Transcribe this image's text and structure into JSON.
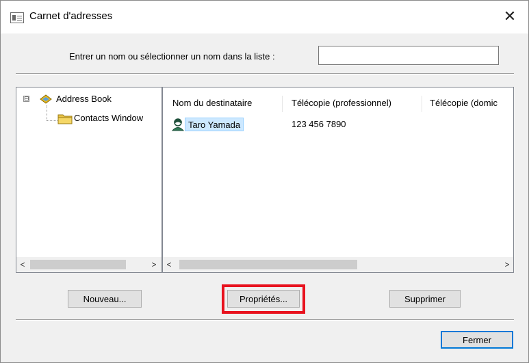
{
  "window": {
    "title": "Carnet d'adresses",
    "close_label": "✕"
  },
  "search": {
    "label": "Entrer un nom ou sélectionner un nom dans la liste :",
    "value": "",
    "placeholder": ""
  },
  "tree": {
    "expander_symbol": "⊟",
    "root_label": "Address Book",
    "child_label": "Contacts Window"
  },
  "list": {
    "columns": [
      "Nom du destinataire",
      "Télécopie (professionnel)",
      "Télécopie (domic"
    ],
    "rows": [
      {
        "name": "Taro Yamada",
        "fax": "123 456 7890"
      }
    ]
  },
  "scrollbars": {
    "left_arrow": "<",
    "right_arrow": ">"
  },
  "buttons": {
    "new": "Nouveau...",
    "properties": "Propriétés...",
    "delete": "Supprimer",
    "close": "Fermer"
  },
  "colors": {
    "selection": "#cce8ff",
    "highlight": "#e8121e",
    "default_button_border": "#0078d7"
  },
  "icons": {
    "app": "address-book-window-icon",
    "book": "address-book-icon",
    "folder": "folder-icon",
    "contact": "contact-person-icon"
  }
}
